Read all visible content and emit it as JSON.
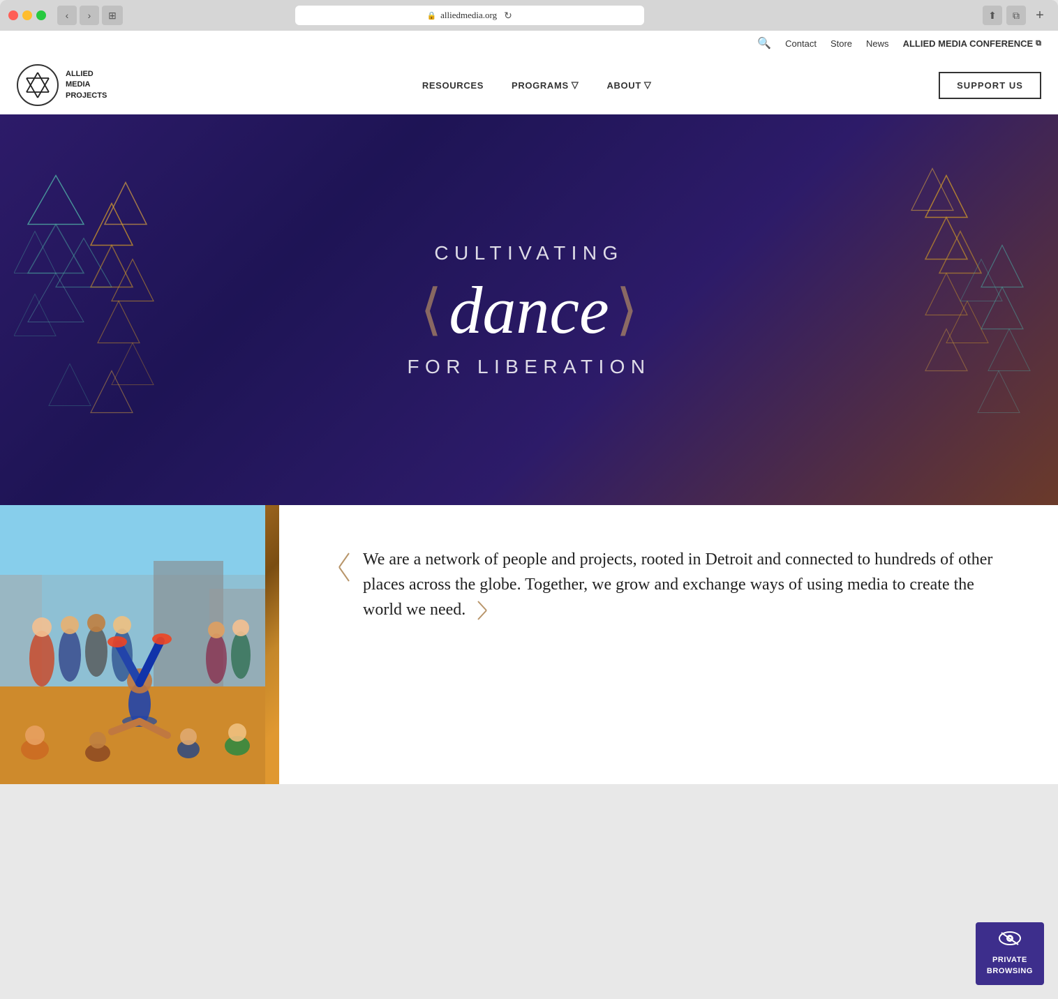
{
  "browser": {
    "url": "alliedmedia.org",
    "dots": [
      "red",
      "yellow",
      "green"
    ],
    "back_btn": "‹",
    "forward_btn": "›",
    "sidebar_btn": "⊞",
    "reload_btn": "↻",
    "share_btn": "⬆",
    "fullscreen_btn": "⧉",
    "new_tab_btn": "+"
  },
  "utility_nav": {
    "search_label": "🔍",
    "contact_label": "Contact",
    "store_label": "Store",
    "news_label": "News",
    "amc_label": "ALLIED MEDIA CONFERENCE",
    "amc_ext_icon": "⧉"
  },
  "main_nav": {
    "logo_line1": "ALLIED",
    "logo_line2": "MEDIA",
    "logo_line3": "PROJECTS",
    "resources_label": "RESOURCES",
    "programs_label": "PROGRAMS",
    "about_label": "ABOUT",
    "support_label": "SUPPORT US",
    "dropdown_char": "▽"
  },
  "hero": {
    "cultivating": "CULTIVATING",
    "dance": "dance",
    "liberation": "FOR LIBERATION"
  },
  "content": {
    "bracket": "❬",
    "body_text": "We are a network of people and projects, rooted in Detroit and connected to hundreds of other places across the globe. Together, we grow and exchange ways of using media to create the world we need.",
    "end_bracket": "❭"
  },
  "private_badge": {
    "eye_icon": "👁",
    "line1": "PRIVATE",
    "line2": "BROWSING"
  }
}
